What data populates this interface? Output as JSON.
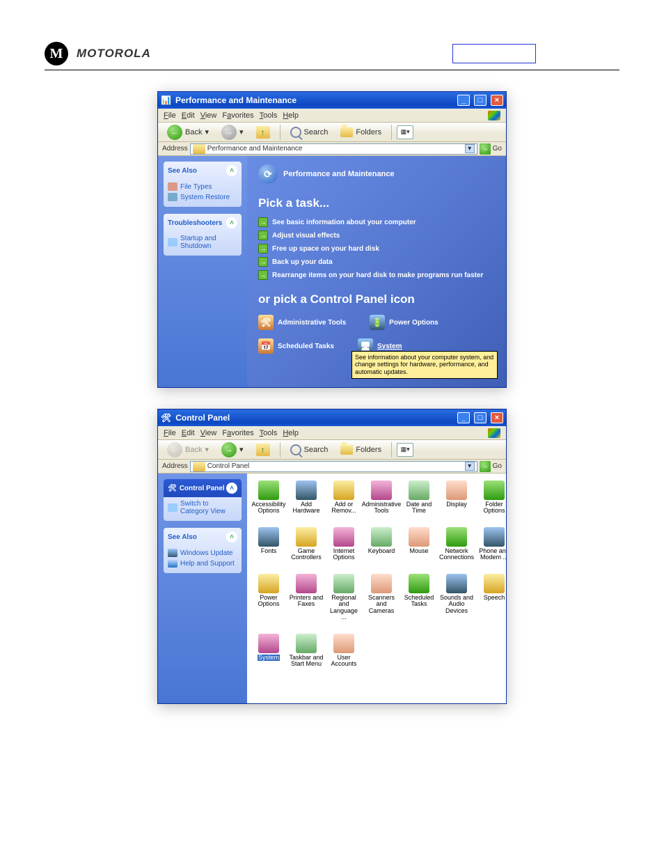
{
  "header": {
    "brand": "MOTOROLA",
    "badge": "",
    "section_label": ""
  },
  "body_text": {
    "above_ss1": "",
    "above_ss2": ""
  },
  "xp_menu": [
    "File",
    "Edit",
    "View",
    "Favorites",
    "Tools",
    "Help"
  ],
  "toolbar": {
    "back": "Back",
    "search": "Search",
    "folders": "Folders",
    "go": "Go",
    "address_label": "Address"
  },
  "screenshot1": {
    "title": "Performance and Maintenance",
    "address": "Performance and Maintenance",
    "side": {
      "see_also": {
        "title": "See Also",
        "items": [
          "File Types",
          "System Restore"
        ]
      },
      "trouble": {
        "title": "Troubleshooters",
        "items": [
          "Startup and Shutdown"
        ]
      }
    },
    "main": {
      "heading": "Performance and Maintenance",
      "pick_task": "Pick a task...",
      "tasks": [
        "See basic information about your computer",
        "Adjust visual effects",
        "Free up space on your hard disk",
        "Back up your data",
        "Rearrange items on your hard disk to make programs run faster"
      ],
      "or_pick": "or pick a Control Panel icon",
      "icons": [
        "Administrative Tools",
        "Power Options",
        "Scheduled Tasks",
        "System"
      ],
      "tooltip": "See information about your computer system, and change settings for hardware, performance, and automatic updates."
    }
  },
  "screenshot2": {
    "title": "Control Panel",
    "address": "Control Panel",
    "side": {
      "cp": {
        "title": "Control Panel",
        "items": [
          "Switch to Category View"
        ]
      },
      "see": {
        "title": "See Also",
        "items": [
          "Windows Update",
          "Help and Support"
        ]
      }
    },
    "main": {
      "selected": "System",
      "items": [
        "Accessibility Options",
        "Add Hardware",
        "Add or Remov...",
        "Administrative Tools",
        "Date and Time",
        "Display",
        "Folder Options",
        "Fonts",
        "Game Controllers",
        "Internet Options",
        "Keyboard",
        "Mouse",
        "Network Connections",
        "Phone and Modem ...",
        "Power Options",
        "Printers and Faxes",
        "Regional and Language ...",
        "Scanners and Cameras",
        "Scheduled Tasks",
        "Sounds and Audio Devices",
        "Speech",
        "System",
        "Taskbar and Start Menu",
        "User Accounts"
      ]
    }
  }
}
